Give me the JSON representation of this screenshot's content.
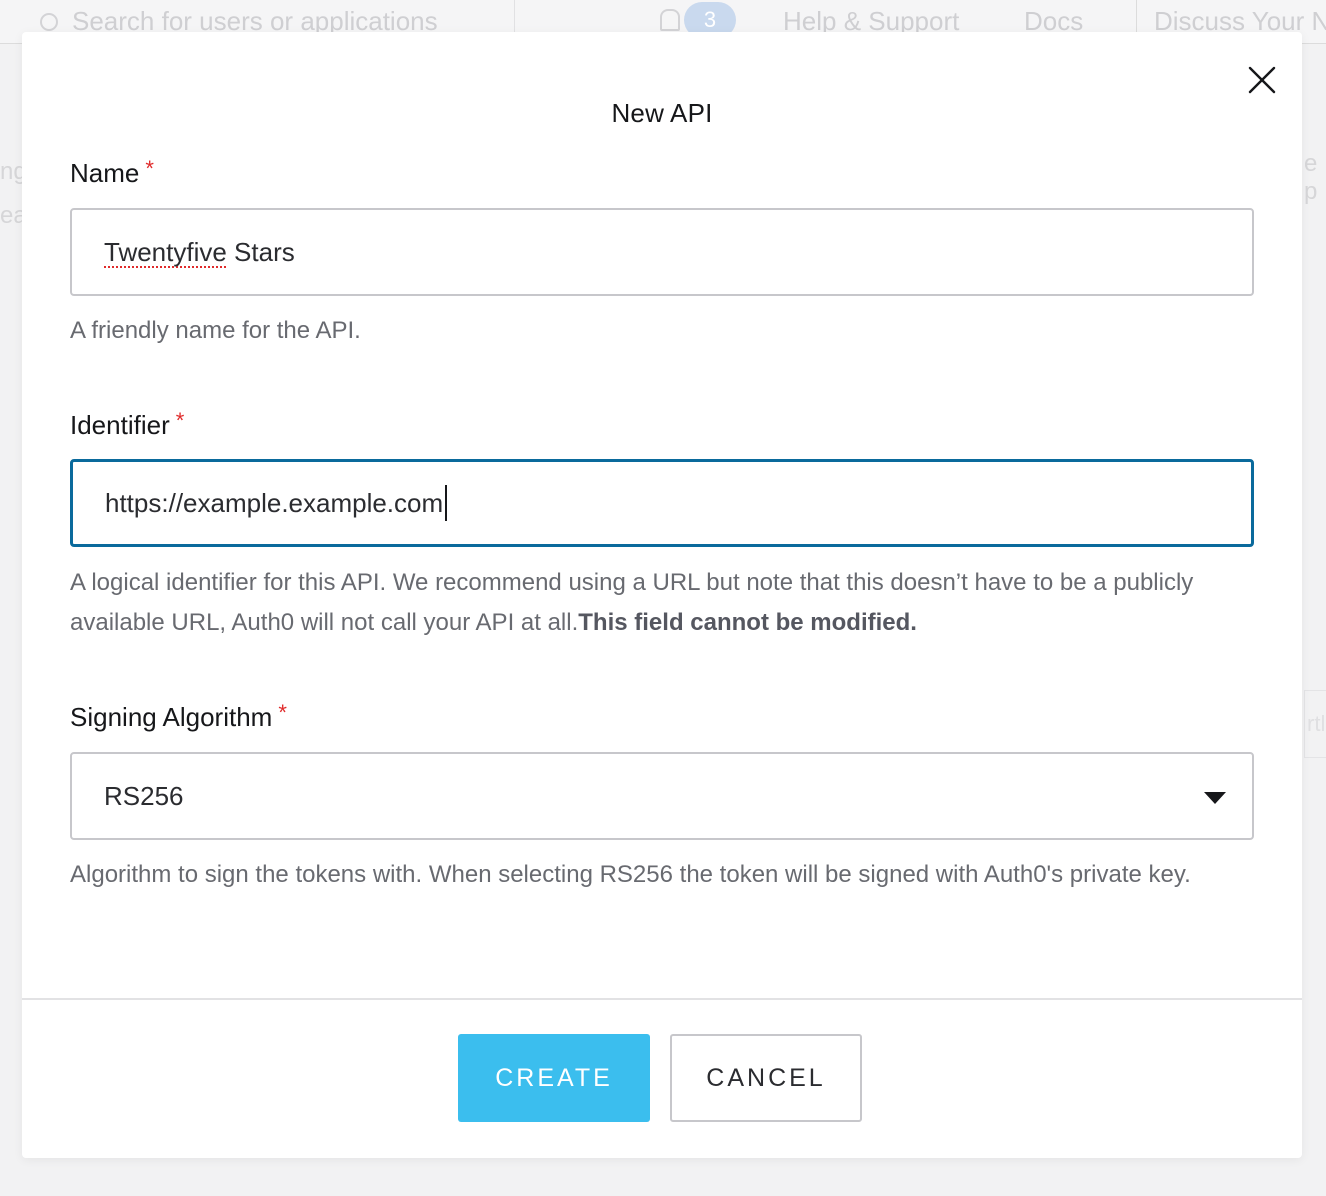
{
  "background": {
    "search_placeholder": "Search for users or applications",
    "notification_count": "3",
    "help_link": "Help & Support",
    "docs_link": "Docs",
    "discuss_link": "Discuss Your N",
    "edge_left_fragment_1": "ng",
    "edge_left_fragment_2": "ea",
    "edge_right_fragment_1": "e p",
    "edge_right_fragment_2": "rtl"
  },
  "modal": {
    "title": "New API",
    "close_icon": "close-icon",
    "fields": {
      "name": {
        "label": "Name",
        "required_mark": "*",
        "value_misspelled": "Twentyfive",
        "value_rest": " Stars",
        "help": "A friendly name for the API."
      },
      "identifier": {
        "label": "Identifier",
        "required_mark": "*",
        "value": "https://example.example.com",
        "help_prefix": "A logical identifier for this API. We recommend using a URL but note that this doesn’t have to be a publicly available URL, Auth0 will not call your API at all.",
        "help_bold": "This field cannot be modified."
      },
      "signing_algorithm": {
        "label": "Signing Algorithm",
        "required_mark": "*",
        "selected": "RS256",
        "help": "Algorithm to sign the tokens with. When selecting RS256 the token will be signed with Auth0's private key."
      }
    },
    "buttons": {
      "create": "CREATE",
      "cancel": "CANCEL"
    }
  },
  "colors": {
    "accent_create": "#3bbeee",
    "focus_border": "#0a6a9c",
    "required": "#e02b2b"
  }
}
